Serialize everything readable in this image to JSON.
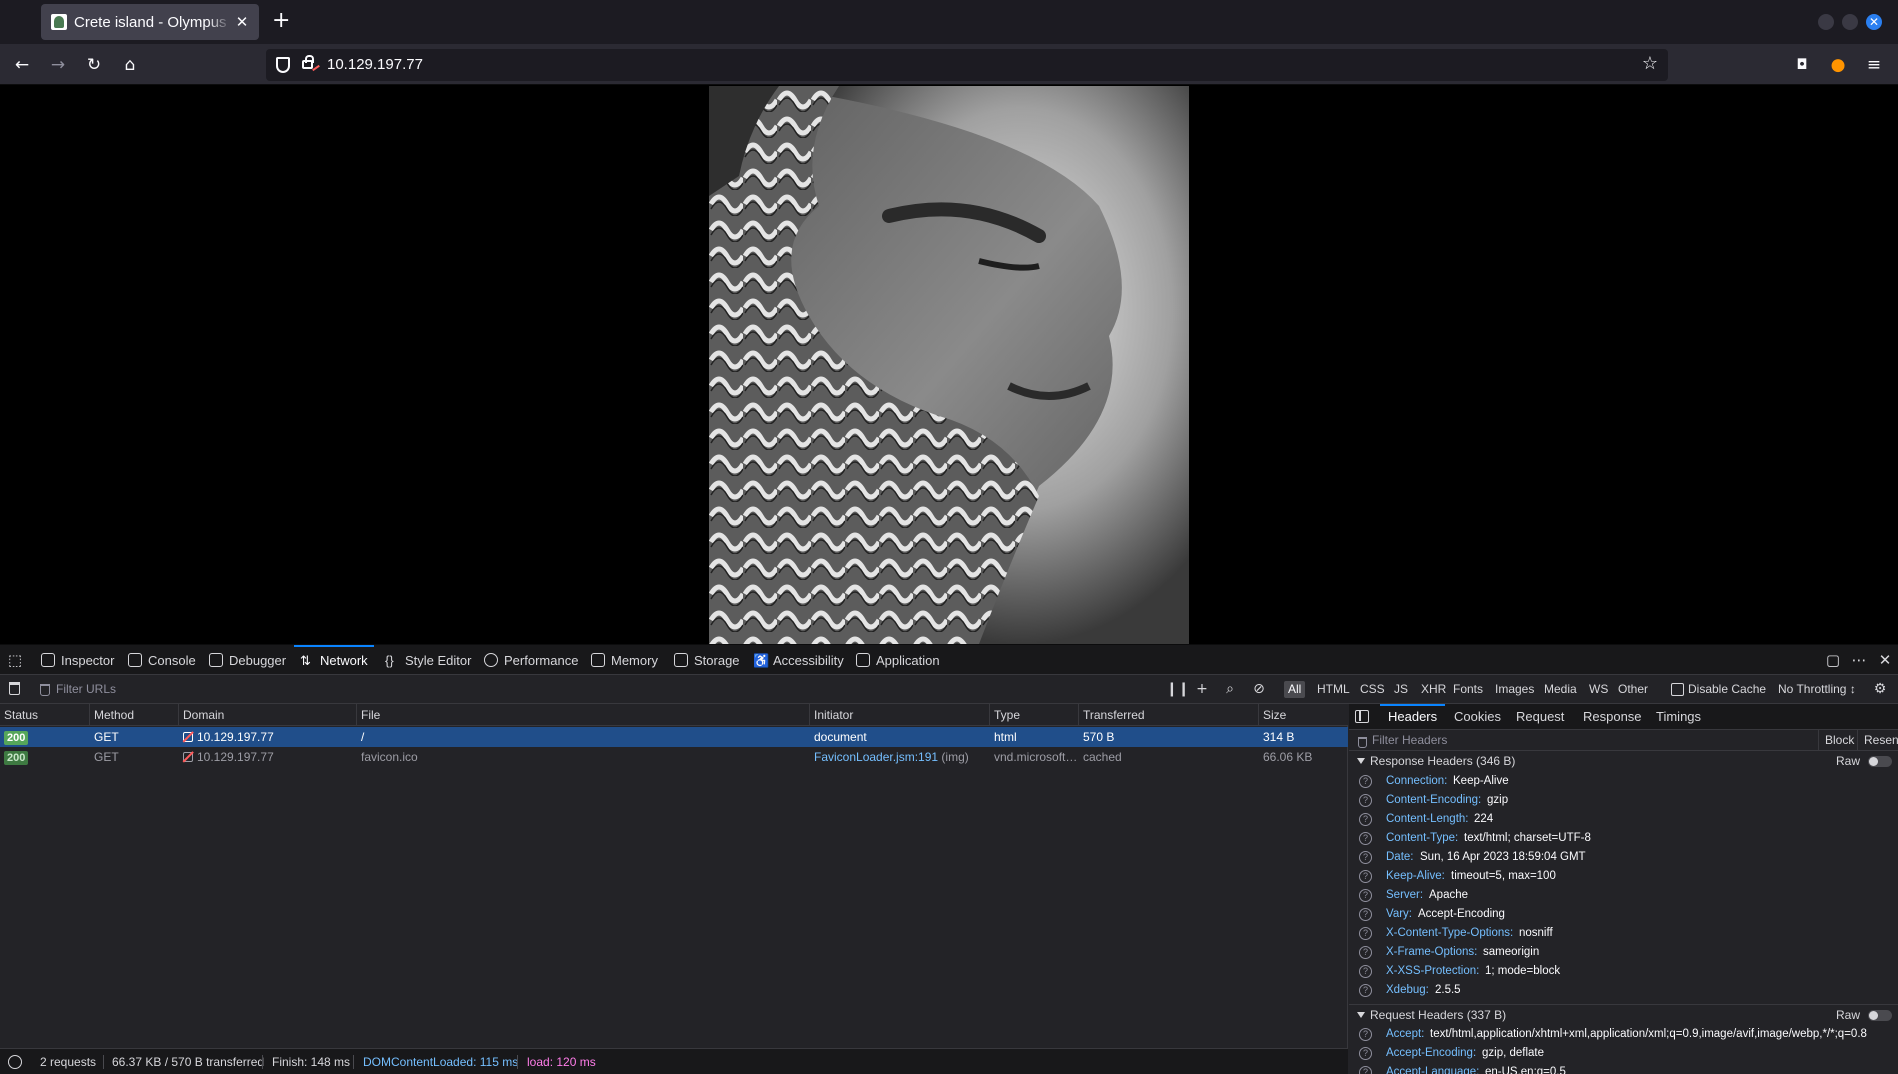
{
  "browser": {
    "tab_title": "Crete island - Olympus HTB",
    "url": "10.129.197.77",
    "icons": [
      "back-icon",
      "forward-icon",
      "reload-icon",
      "home-icon",
      "shield-icon",
      "lock-insecure-icon",
      "star-icon",
      "pocket-icon",
      "firefox-account-icon",
      "menu-icon"
    ]
  },
  "devtools": {
    "tabs": [
      "Inspector",
      "Console",
      "Debugger",
      "Network",
      "Style Editor",
      "Performance",
      "Memory",
      "Storage",
      "Accessibility",
      "Application"
    ],
    "active_tab": "Network",
    "network": {
      "filter_placeholder": "Filter URLs",
      "type_filters": [
        "All",
        "HTML",
        "CSS",
        "JS",
        "XHR",
        "Fonts",
        "Images",
        "Media",
        "WS",
        "Other"
      ],
      "active_type_filter": "All",
      "disable_cache_label": "Disable Cache",
      "throttling_label": "No Throttling ↕",
      "columns": [
        "Status",
        "Method",
        "Domain",
        "File",
        "Initiator",
        "Type",
        "Transferred",
        "Size"
      ],
      "rows": [
        {
          "status": "200",
          "method": "GET",
          "domain": "10.129.197.77",
          "file": "/",
          "initiator": "document",
          "initiator_detail": "",
          "type": "html",
          "transferred": "570 B",
          "size": "314 B"
        },
        {
          "status": "200",
          "method": "GET",
          "domain": "10.129.197.77",
          "file": "favicon.ico",
          "initiator": "FaviconLoader.jsm:191",
          "initiator_detail": " (img)",
          "type": "vnd.microsoft…",
          "transferred": "cached",
          "size": "66.06 KB"
        }
      ],
      "summary": {
        "requests": "2 requests",
        "transferred": "66.37 KB / 570 B transferred",
        "finish": "Finish: 148 ms",
        "dom_content_loaded": "DOMContentLoaded: 115 ms",
        "load": "load: 120 ms"
      }
    },
    "side_panel": {
      "tabs": [
        "Headers",
        "Cookies",
        "Request",
        "Response",
        "Timings"
      ],
      "active_tab": "Headers",
      "filter_placeholder": "Filter Headers",
      "block_label": "Block",
      "resend_label": "Resend",
      "raw_label": "Raw",
      "response_section": "Response Headers (346 B)",
      "response_headers": [
        {
          "name": "Connection:",
          "value": "Keep-Alive"
        },
        {
          "name": "Content-Encoding:",
          "value": "gzip"
        },
        {
          "name": "Content-Length:",
          "value": "224"
        },
        {
          "name": "Content-Type:",
          "value": "text/html; charset=UTF-8"
        },
        {
          "name": "Date:",
          "value": "Sun, 16 Apr 2023 18:59:04 GMT"
        },
        {
          "name": "Keep-Alive:",
          "value": "timeout=5, max=100"
        },
        {
          "name": "Server:",
          "value": "Apache"
        },
        {
          "name": "Vary:",
          "value": "Accept-Encoding"
        },
        {
          "name": "X-Content-Type-Options:",
          "value": "nosniff"
        },
        {
          "name": "X-Frame-Options:",
          "value": "sameorigin"
        },
        {
          "name": "X-XSS-Protection:",
          "value": "1; mode=block"
        },
        {
          "name": "Xdebug:",
          "value": "2.5.5"
        }
      ],
      "request_section": "Request Headers (337 B)",
      "request_headers": [
        {
          "name": "Accept:",
          "value": "text/html,application/xhtml+xml,application/xml;q=0.9,image/avif,image/webp,*/*;q=0.8"
        },
        {
          "name": "Accept-Encoding:",
          "value": "gzip, deflate"
        },
        {
          "name": "Accept-Language:",
          "value": "en-US,en;q=0.5"
        }
      ]
    }
  },
  "colors": {
    "accent": "#0a84ff",
    "selected_row": "#204e8a",
    "status_ok": "#56a65a",
    "header_name": "#75bfff",
    "dom_loaded": "#75bfff",
    "load": "#ff7de9"
  }
}
